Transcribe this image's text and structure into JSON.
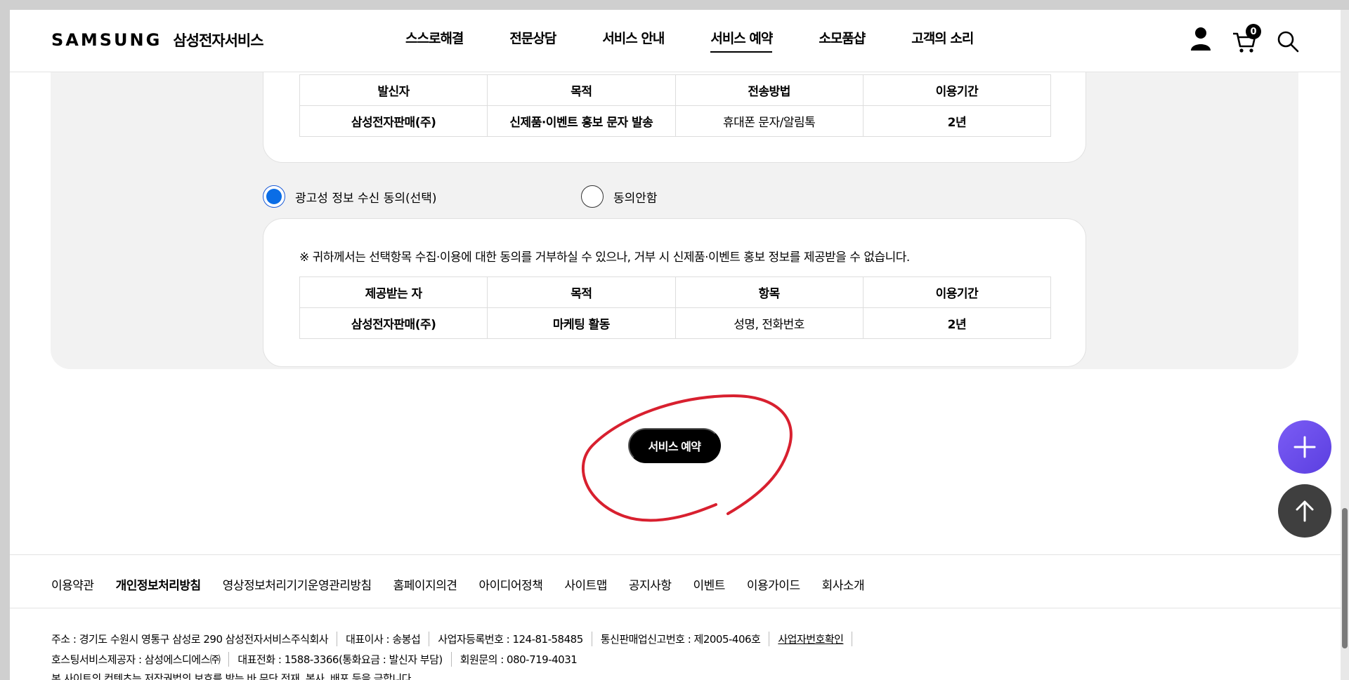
{
  "header": {
    "logo_word": "SAMSUNG",
    "logo_sub": "삼성전자서비스",
    "nav": [
      "스스로해결",
      "전문상담",
      "서비스 안내",
      "서비스 예약",
      "소모품샵",
      "고객의 소리"
    ],
    "active_nav": "서비스 예약",
    "cart_count": "0"
  },
  "table1": {
    "headers": [
      "발신자",
      "목적",
      "전송방법",
      "이용기간"
    ],
    "row": [
      "삼성전자판매(주)",
      "신제품·이벤트 홍보 문자 발송",
      "휴대폰 문자/알림톡",
      "2년"
    ]
  },
  "consent": {
    "agree_label": "광고성 정보 수신 동의(선택)",
    "disagree_label": "동의안함",
    "selected": "agree"
  },
  "table2": {
    "note": "※ 귀하께서는 선택항목 수집·이용에 대한 동의를 거부하실 수 있으나, 거부 시 신제품·이벤트 홍보 정보를 제공받을 수 없습니다.",
    "headers": [
      "제공받는 자",
      "목적",
      "항목",
      "이용기간"
    ],
    "row": [
      "삼성전자판매(주)",
      "마케팅 활동",
      "성명, 전화번호",
      "2년"
    ]
  },
  "cta_label": "서비스 예약",
  "footer": {
    "links": [
      "이용약관",
      "개인정보처리방침",
      "영상정보처리기기운영관리방침",
      "홈페이지의견",
      "아이디어정책",
      "사이트맵",
      "공지사항",
      "이벤트",
      "이용가이드",
      "회사소개"
    ],
    "line1": [
      "주소 : 경기도 수원시 영통구 삼성로 290 삼성전자서비스주식회사",
      "대표이사 : 송봉섭",
      "사업자등록번호 : 124-81-58485",
      "통신판매업신고번호 : 제2005-406호",
      "사업자번호확인"
    ],
    "line2": [
      "호스팅서비스제공자 : 삼성에스디에스㈜",
      "대표전화 : 1588-3366(통화요금 : 발신자 부담)",
      "회원문의 : 080-719-4031"
    ],
    "line3": "본 사이트의 컨텐츠는 저작권법의 보호를 받는 바 무단 전재, 복사, 배포 등을 금합니다."
  },
  "colors": {
    "radio_on": "#0a6de6",
    "annotation_red": "#d8202f",
    "fab_purple": "#6b4cec",
    "fab_dark": "#3f3f3f"
  }
}
